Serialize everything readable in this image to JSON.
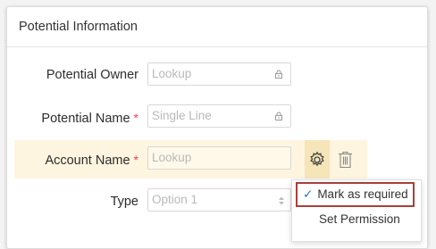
{
  "section": {
    "title": "Potential Information"
  },
  "fields": {
    "owner": {
      "label": "Potential Owner",
      "placeholder": "Lookup"
    },
    "name": {
      "label": "Potential Name",
      "placeholder": "Single Line",
      "required_mark": "*"
    },
    "account": {
      "label": "Account Name",
      "placeholder": "Lookup",
      "required_mark": "*"
    },
    "type": {
      "label": "Type",
      "placeholder": "Option 1"
    }
  },
  "menu": {
    "mark_required": "Mark as required",
    "set_permission": "Set Permission",
    "check_glyph": "✓"
  },
  "colors": {
    "highlight_row": "#fdf5df",
    "icon_box": "#f5e5b8",
    "required": "#e44444",
    "menu_border": "#a7403a"
  },
  "icons": [
    "lock-icon",
    "gear-icon",
    "trash-icon",
    "stepper-icon",
    "check-icon"
  ]
}
